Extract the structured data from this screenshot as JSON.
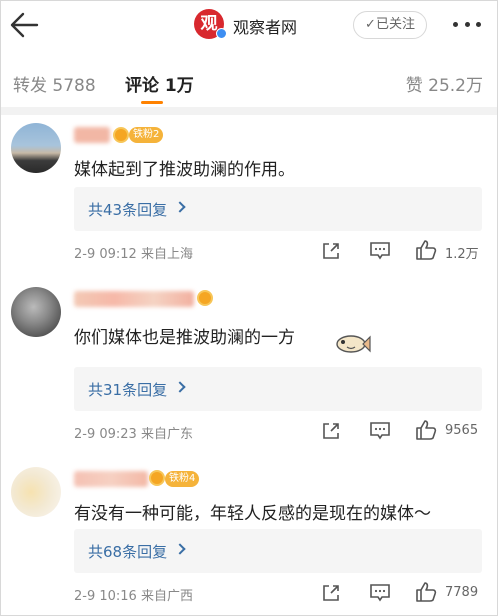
{
  "header": {
    "logo_char": "观",
    "account_name": "观察者网",
    "follow_label": "✓已关注"
  },
  "tabs": [
    {
      "label": "转发 5788"
    },
    {
      "label": "评论 1万"
    },
    {
      "label": "赞 25.2万"
    }
  ],
  "comments": [
    {
      "fan_badge": "铁粉2",
      "text": "媒体起到了推波助澜的作用。",
      "replies": "共43条回复",
      "meta": "2-9 09:12  来自上海",
      "likes": "1.2万"
    },
    {
      "fan_badge": "",
      "text": "你们媒体也是推波助澜的一方",
      "replies": "共31条回复",
      "meta": "2-9 09:23  来自广东",
      "likes": "9565"
    },
    {
      "fan_badge": "铁粉4",
      "text": "有没有一种可能，年轻人反感的是现在的媒体～",
      "replies": "共68条回复",
      "meta": "2-9 10:16  来自广西",
      "likes": "7789"
    }
  ],
  "icons": {
    "back": "back-arrow-icon",
    "more": "more-dots-icon",
    "share": "share-icon",
    "comment": "comment-icon",
    "like": "thumbs-up-icon"
  },
  "colors": {
    "accent": "#ff8200",
    "link": "#3a6ea5",
    "logo_red": "#d8282e",
    "badge_gold": "#f5b33a"
  }
}
